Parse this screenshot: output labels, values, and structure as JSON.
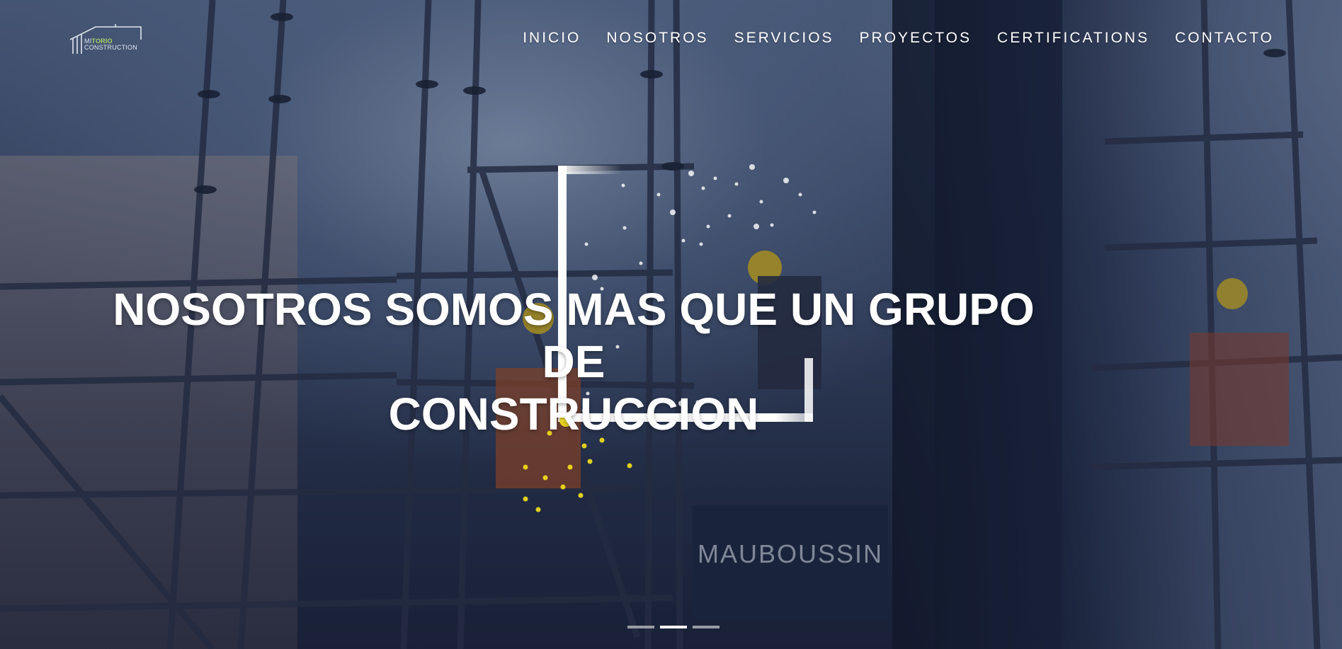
{
  "brand": {
    "logo_prefix": "MI",
    "logo_accent": "TORIO",
    "logo_suffix": "CONSTRUCTION",
    "accent_color": "#a9d46a"
  },
  "nav": {
    "items": [
      {
        "label": "INICIO"
      },
      {
        "label": "NOSOTROS"
      },
      {
        "label": "SERVICIOS"
      },
      {
        "label": "PROYECTOS"
      },
      {
        "label": "CERTIFICATIONS"
      },
      {
        "label": "CONTACTO"
      }
    ]
  },
  "hero": {
    "headline_line1": "NOSOTROS SOMOS MAS QUE UN GRUPO DE",
    "headline_line2": "CONSTRUCCION",
    "sign_text": "MAUBOUSSIN",
    "particle_color": "#f5e21b",
    "frame_color": "#ffffff"
  },
  "slider": {
    "count": 3,
    "active_index": 1
  }
}
